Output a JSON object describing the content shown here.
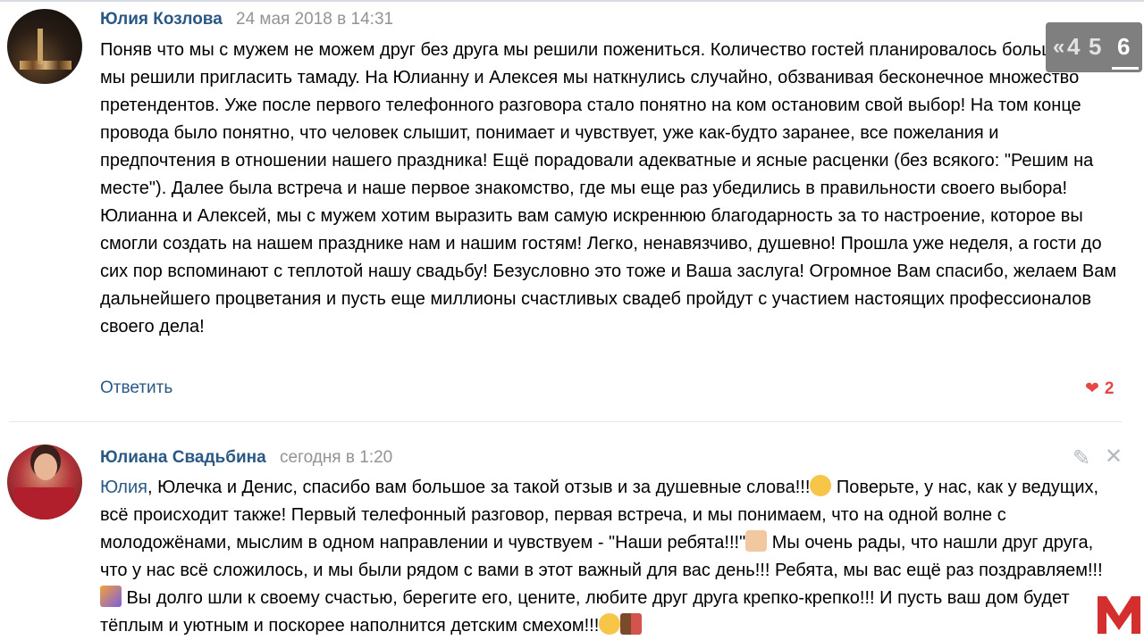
{
  "comments": [
    {
      "author": "Юлия Козлова",
      "date": "24 мая 2018 в 14:31",
      "text": "Поняв что мы с мужем не можем друг без друга мы решили пожениться. Количество гостей планировалось большое и мы решили пригласить тамаду. На Юлианну и Алексея мы наткнулись случайно, обзванивая бесконечное множество претендентов. Уже после первого телефонного разговора стало понятно на ком остановим свой выбор! На том конце провода было понятно, что человек слышит, понимает и чувствует, уже как-будто заранее, все пожелания и предпочтения в отношении нашего праздника! Ещё порадовали адекватные и ясные расценки (без всякого: \"Решим на месте\"). Далее была встреча и наше первое знакомство, где мы еще раз убедились в правильности своего выбора! Юлианна и Алексей, мы с мужем хотим выразить вам самую искреннюю благодарность за то настроение, которое вы смогли создать на нашем празднике нам и нашим гостям! Легко, ненавязчиво, душевно! Прошла уже неделя, а гости до сих пор вспоминают с теплотой нашу свадьбу! Безусловно это тоже и Ваша заслуга! Огромное Вам спасибо, желаем Вам дальнейшего процветания и пусть еще миллионы счастливых свадеб пройдут с участием настоящих профессионалов своего дела!",
      "reply_label": "Ответить",
      "likes": "2"
    },
    {
      "author": "Юлиана Свадьбина",
      "date": "сегодня в 1:20",
      "mention": "Юлия",
      "text_1": ", Юлечка и Денис, спасибо вам большое за такой отзыв и за душевные слова!!!",
      "text_2": " Поверьте, у нас, как у ведущих, всё происходит также! Первый телефонный разговор, первая встреча, и мы понимаем, что на одной волне с молодожёнами, мыслим в одном направлении и чувствуем - \"Наши ребята!!!\"",
      "text_3": " Мы очень рады, что нашли друг друга, что у нас всё сложилось, и мы были рядом с вами в этот важный для вас день!!! Ребята, мы вас ещё раз поздравляем!!!",
      "text_4": " Вы долго шли к своему счастью, берегите его, цените, любите друг друга крепко-крепко!!! И пусть ваш дом будет тёплым и уютным и поскорее наполнится детским смехом!!!",
      "emojis": [
        "smile",
        "thumbs-up",
        "party-popper",
        "wink",
        "couple"
      ]
    }
  ],
  "pager": {
    "prev": "«",
    "pages": [
      "4",
      "5",
      "6"
    ],
    "current": "6"
  },
  "icons": {
    "edit": "pencil-icon",
    "close": "close-icon",
    "heart": "heart-icon",
    "logo": "m-logo"
  },
  "colors": {
    "link": "#2a5885",
    "date": "#939393",
    "like": "#e64646",
    "logo": "#d32f2f"
  }
}
